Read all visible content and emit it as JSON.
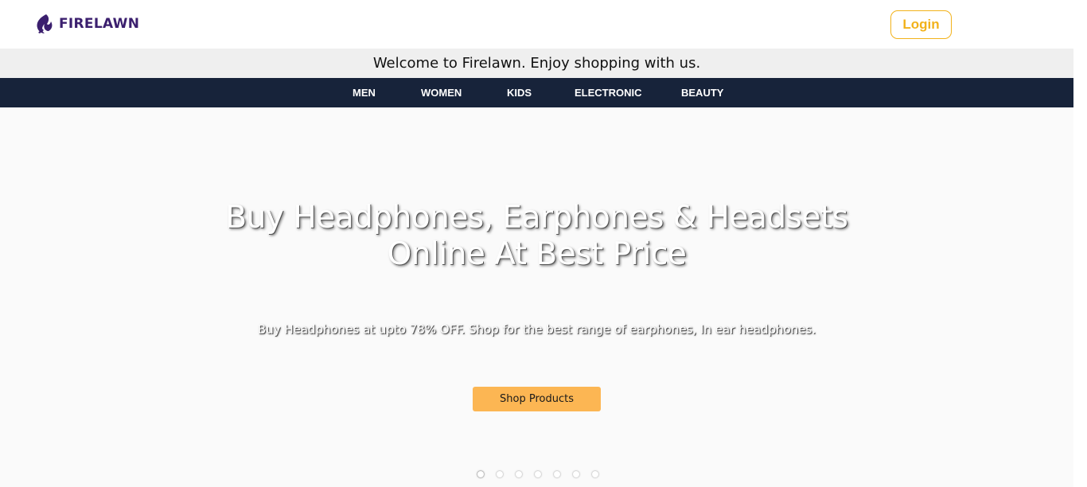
{
  "header": {
    "brand_name": "FIRELAWN",
    "login_label": "Login",
    "brand_color": "#3b1f6e",
    "accent_color": "#f2b21b"
  },
  "welcome": {
    "text": "Welcome to Firelawn. Enjoy shopping with us."
  },
  "nav": {
    "items": [
      {
        "label": "MEN"
      },
      {
        "label": "WOMEN"
      },
      {
        "label": "KIDS"
      },
      {
        "label": "ELECTRONIC"
      },
      {
        "label": "BEAUTY"
      }
    ],
    "background_color": "#17233a"
  },
  "hero": {
    "title_line1": "Buy Headphones, Earphones & Headsets",
    "title_line2": "Online At Best Price",
    "subtitle": "Buy Headphones at upto 78% OFF. Shop for the best range of earphones, In ear headphones.",
    "cta_label": "Shop Products",
    "cta_color": "#fcb653",
    "carousel": {
      "slide_count": 7,
      "active_index": 0
    }
  }
}
